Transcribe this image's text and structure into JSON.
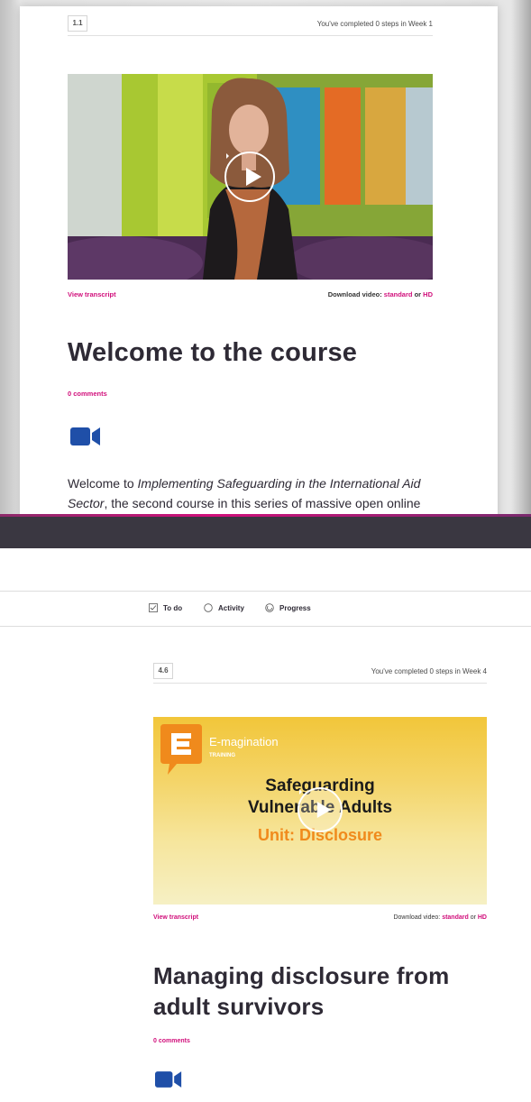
{
  "top_step": {
    "number": "1.1",
    "progress_text": "You've completed 0 steps in Week 1",
    "view_transcript": "View transcript",
    "download_label": "Download video: ",
    "download_standard": "standard",
    "download_or": " or ",
    "download_hd": "HD",
    "title": "Welcome to the course",
    "comments": "0 comments",
    "body_prefix": "Welcome to ",
    "body_italic_1": "Implementing Safeguarding in the International Aid",
    "body_italic_2": "Sector",
    "body_suffix": ", the second course in this series of massive open online"
  },
  "nav": {
    "items": [
      {
        "label": "To do",
        "icon": "checkbox-icon"
      },
      {
        "label": "Activity",
        "icon": "circle-icon"
      },
      {
        "label": "Progress",
        "icon": "progress-ring-icon"
      }
    ]
  },
  "bottom_step": {
    "number": "4.6",
    "progress_text": "You've completed 0 steps in Week 4",
    "video_brand": "E-magination",
    "video_brand_sub": "TRAINING",
    "video_title_1": "Safeguarding",
    "video_title_2": "Vulnerable Adults",
    "video_unit": "Unit: Disclosure",
    "view_transcript": "View transcript",
    "download_label": "Download video: ",
    "download_standard": "standard",
    "download_or": " or ",
    "download_hd": "HD",
    "title_line_1": "Managing disclosure from",
    "title_line_2": "adult survivors",
    "comments": "0 comments"
  },
  "colors": {
    "accent": "#d10f7b",
    "video_icon": "#1f4fa8",
    "dark_band": "#3a3741",
    "video_orange": "#f08a1c"
  }
}
